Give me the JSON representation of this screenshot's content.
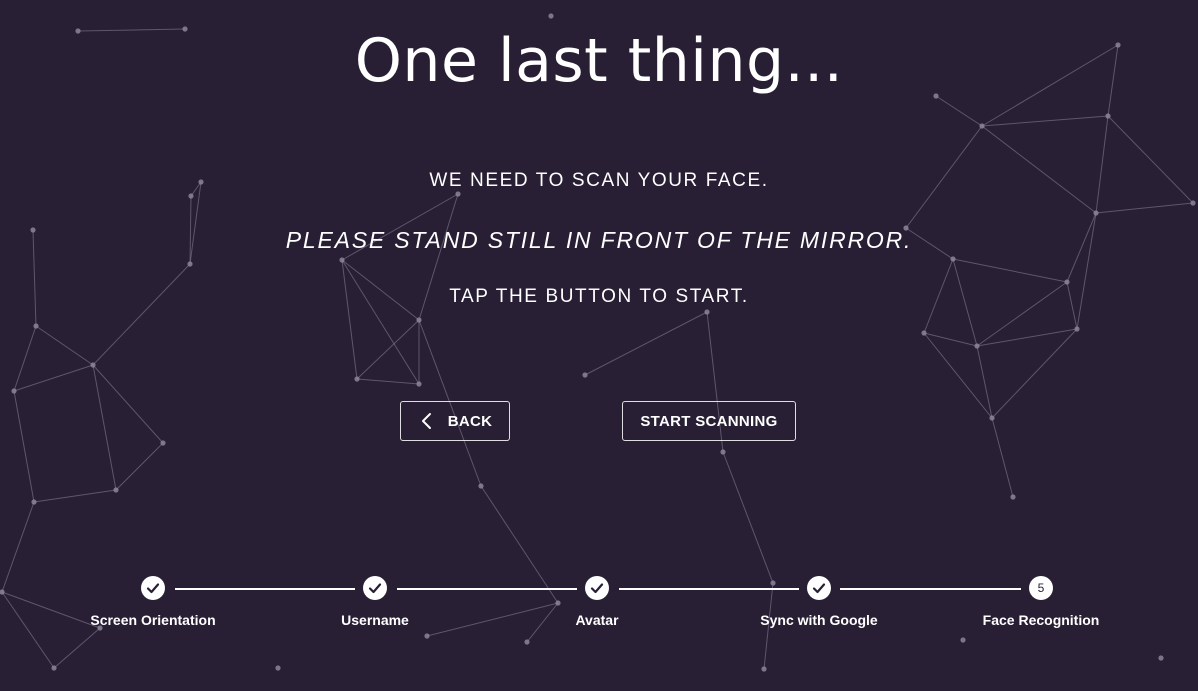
{
  "heading": {
    "title": "One last thing...",
    "line1": "WE NEED TO SCAN YOUR FACE.",
    "line2": "PLEASE STAND STILL IN FRONT OF THE MIRROR.",
    "line3": "TAP THE BUTTON TO START."
  },
  "actions": {
    "back_label": "BACK",
    "start_label": "START SCANNING"
  },
  "progress": {
    "steps": [
      {
        "label": "Screen Orientation",
        "state": "done",
        "icon": "check-icon"
      },
      {
        "label": "Username",
        "state": "done",
        "icon": "check-icon"
      },
      {
        "label": "Avatar",
        "state": "done",
        "icon": "check-icon"
      },
      {
        "label": "Sync with Google",
        "state": "done",
        "icon": "check-icon"
      },
      {
        "label": "Face Recognition",
        "state": "current",
        "number": "5"
      }
    ]
  },
  "colors": {
    "background": "#281f35",
    "foreground": "#ffffff",
    "network": "#8c8499"
  }
}
